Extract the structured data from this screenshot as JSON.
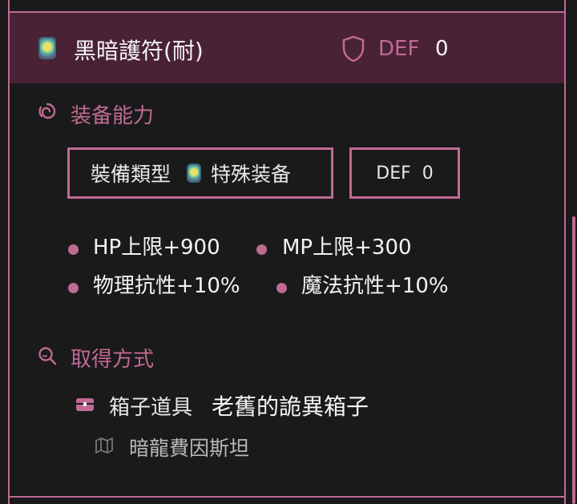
{
  "item": {
    "name": "黑暗護符(耐)",
    "def_label": "DEF",
    "def_value": "0"
  },
  "equip_section": {
    "title": "装备能力",
    "type_label": "裝備類型",
    "type_value": "特殊装备",
    "def_box": "DEF  0",
    "stats": [
      "HP上限+900",
      "MP上限+300",
      "物理抗性+10%",
      "魔法抗性+10%"
    ]
  },
  "source_section": {
    "title": "取得方式",
    "source_type": "箱子道具",
    "source_name": "老舊的詭異箱子",
    "location": "暗龍費因斯坦"
  },
  "colors": {
    "accent": "#c06a93",
    "header_bg": "#4a2235",
    "bg": "#1a1a1a"
  }
}
